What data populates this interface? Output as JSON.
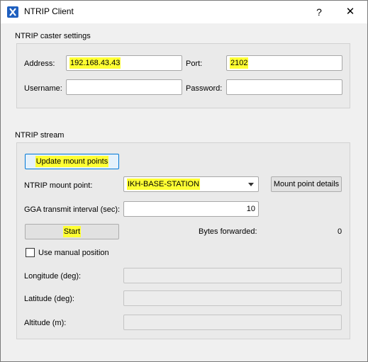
{
  "window": {
    "title": "NTRIP Client",
    "help_label": "?",
    "close_label": "✕",
    "app_icon": "ntrip-x-logo-icon"
  },
  "caster": {
    "section_label": "NTRIP caster settings",
    "address_label": "Address:",
    "address_value": "192.168.43.43",
    "port_label": "Port:",
    "port_value": "2102",
    "username_label": "Username:",
    "username_value": "",
    "password_label": "Password:",
    "password_value": ""
  },
  "stream": {
    "section_label": "NTRIP stream",
    "update_button": "Update mount points",
    "mount_point_label": "NTRIP mount point:",
    "mount_point_value": "IKH-BASE-STATION",
    "mount_details_button": "Mount point details",
    "gga_label": "GGA transmit interval (sec):",
    "gga_value": "10",
    "start_button": "Start",
    "bytes_label": "Bytes forwarded:",
    "bytes_value": "0",
    "manual_position_label": "Use manual position",
    "manual_position_checked": false,
    "longitude_label": "Longitude (deg):",
    "latitude_label": "Latitude (deg):",
    "altitude_label": "Altitude (m):",
    "longitude_value": "",
    "latitude_value": "",
    "altitude_value": ""
  },
  "colors": {
    "highlight": "#ffff33",
    "window_bg": "#f0f0f0",
    "focus_border": "#0078d7"
  }
}
